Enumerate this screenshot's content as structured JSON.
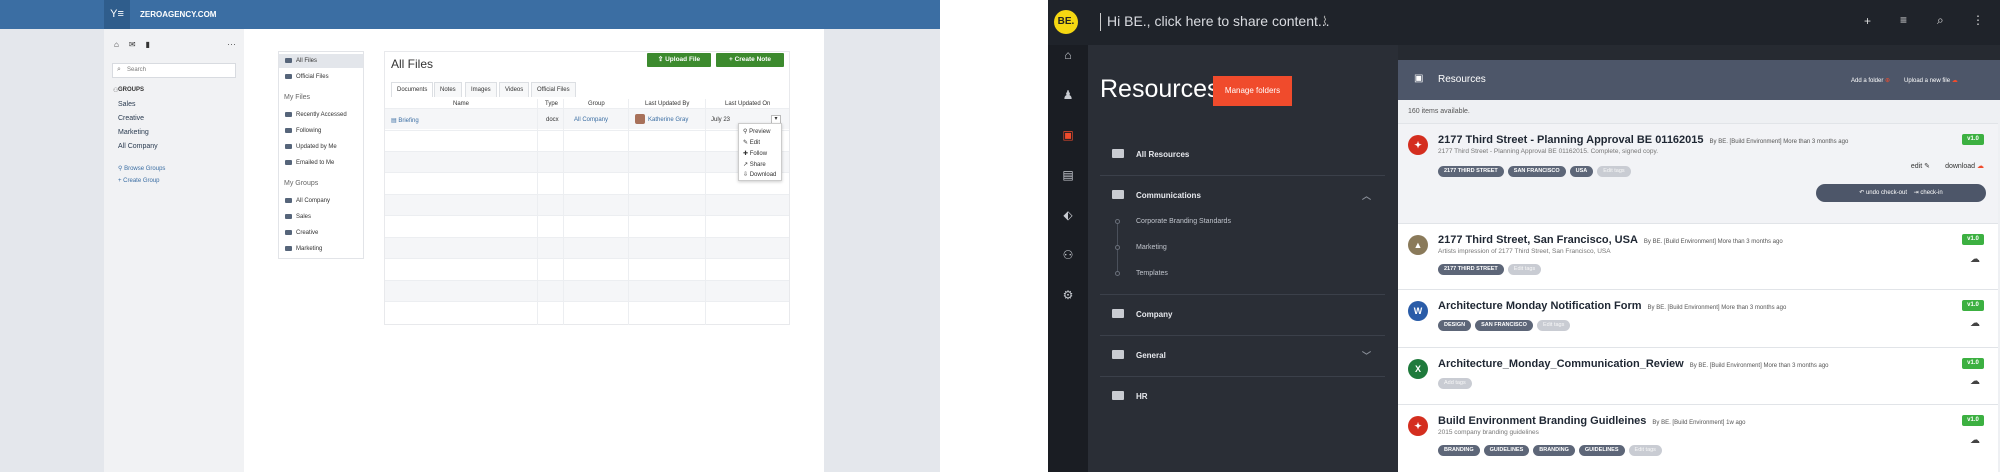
{
  "left": {
    "brand": "Y≡",
    "site": "ZEROAGENCY.COM",
    "search_placeholder": "Search",
    "groups_heading": "GROUPS",
    "groups": [
      "Sales",
      "Creative",
      "Marketing",
      "All Company"
    ],
    "links": [
      "Browse Groups",
      "Create Group"
    ],
    "nav": {
      "top": [
        "All Files",
        "Official Files"
      ],
      "my_files_heading": "My Files",
      "my_files": [
        "Recently Accessed",
        "Following",
        "Updated by Me",
        "Emailed to Me"
      ],
      "my_groups_heading": "My Groups",
      "my_groups": [
        "All Company",
        "Sales",
        "Creative",
        "Marketing"
      ]
    },
    "title": "All Files",
    "buttons": {
      "upload": "Upload File",
      "create": "Create Note"
    },
    "tabs": [
      "Documents",
      "Notes",
      "Images",
      "Videos",
      "Official Files"
    ],
    "columns": [
      "Name",
      "Type",
      "Group",
      "Last Updated By",
      "Last Updated On"
    ],
    "row": {
      "name": "Briefing",
      "type": "docx",
      "group": "All Company",
      "updated_by": "Katherine Gray",
      "updated_on": "July 23"
    },
    "menu": [
      "Preview",
      "Edit",
      "Follow",
      "Share",
      "Download"
    ],
    "colors": {
      "header": "#3b6ea3",
      "button": "#3c8a2e"
    }
  },
  "right": {
    "logo": "BE.",
    "share_prompt": "Hi BE., click here to share content...",
    "title": "Resources",
    "manage": "Manage folders",
    "folders": {
      "all": "All Resources",
      "communications": "Communications",
      "subs": [
        "Corporate Branding Standards",
        "Marketing",
        "Templates"
      ],
      "company": "Company",
      "general": "General",
      "hr": "HR"
    },
    "panel_title": "Resources",
    "add_folder": "Add a folder",
    "upload": "Upload a new file",
    "count": "160 items available.",
    "items": [
      {
        "title": "2177 Third Street - Planning Approval BE 01162015",
        "by": "By BE. [Build Environment]",
        "when": "More than 3 months ago",
        "desc": "2177 Third Street - Planning Approval BE 01162015. Complete, signed copy.",
        "tags": [
          "2177 THIRD STREET",
          "SAN FRANCISCO",
          "USA"
        ],
        "tag_action": "Edit tags",
        "version": "v1.0",
        "icon": "pdf"
      },
      {
        "title": "2177 Third Street, San Francisco, USA",
        "by": "By BE. [Build Environment]",
        "when": "More than 3 months ago",
        "desc": "Artists impression of 2177 Third Street, San Francisco, USA",
        "tags": [
          "2177 THIRD STREET"
        ],
        "tag_action": "Edit tags",
        "version": "v1.0",
        "icon": "image"
      },
      {
        "title": "Architecture Monday Notification Form",
        "by": "By BE. [Build Environment]",
        "when": "More than 3 months ago",
        "desc": "",
        "tags": [
          "DESIGN",
          "SAN FRANCISCO"
        ],
        "tag_action": "Edit tags",
        "version": "v1.0",
        "icon": "word"
      },
      {
        "title": "Architecture_Monday_Communication_Review",
        "by": "By BE. [Build Environment]",
        "when": "More than 3 months ago",
        "desc": "",
        "tags": [],
        "tag_action": "Add tags",
        "version": "v1.0",
        "icon": "excel"
      },
      {
        "title": "Build Environment Branding Guidleines",
        "by": "By BE. [Build Environment]",
        "when": "1w ago",
        "desc": "2015 company branding guidelines",
        "tags": [
          "BRANDING",
          "GUIDELINES",
          "BRANDING",
          "GUIDELINES"
        ],
        "tag_action": "Edit tags",
        "version": "v1.0",
        "icon": "pdf"
      }
    ],
    "actions": {
      "edit": "edit",
      "download": "download",
      "undo": "undo check-out",
      "checkin": "check-in"
    },
    "colors": {
      "accent": "#f04b2c",
      "version": "#3cb041",
      "logo": "#f5d712"
    }
  }
}
